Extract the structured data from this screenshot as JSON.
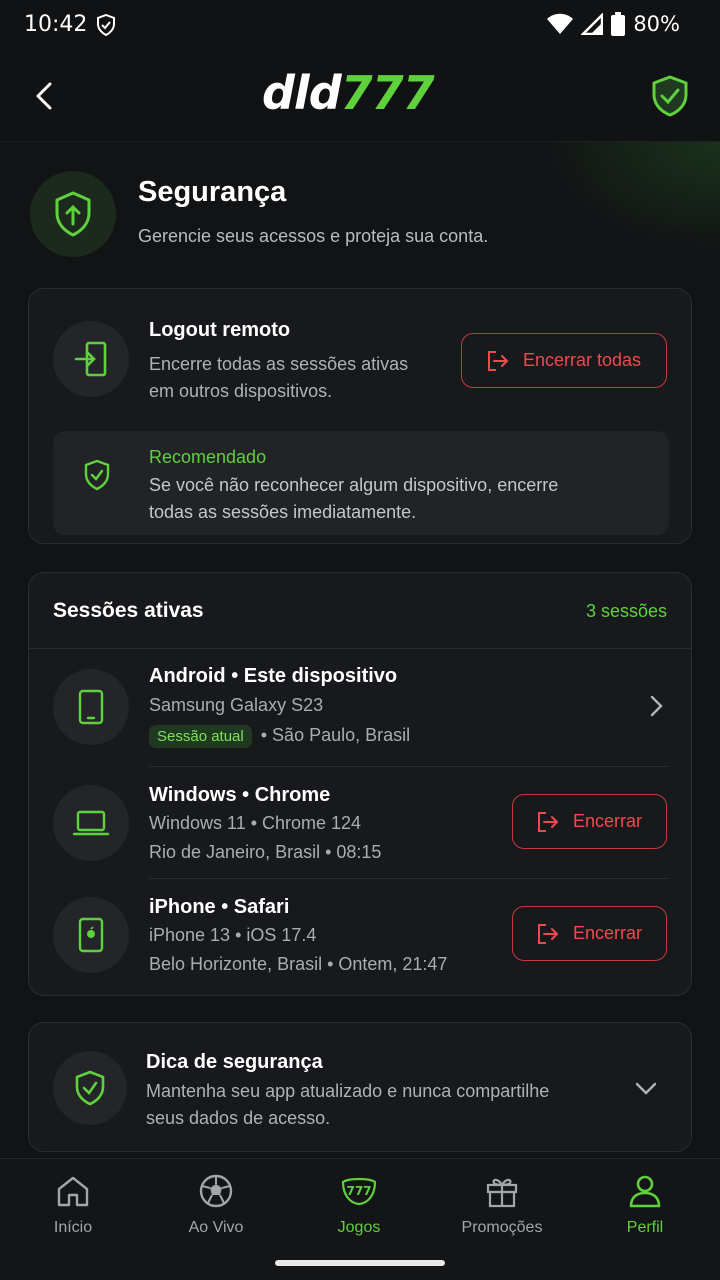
{
  "status_bar": {
    "time": "10:42",
    "battery": "80%"
  },
  "header": {
    "logo_white": "dld",
    "logo_green": "777"
  },
  "page": {
    "title": "Segurança",
    "subtitle": "Gerencie seus acessos e proteja sua conta."
  },
  "logout_card": {
    "title": "Logout remoto",
    "text_line1": "Encerre todas as sessões ativas",
    "text_line2": "em outros dispositivos.",
    "button_label": "Encerrar todas",
    "reco_title": "Recomendado",
    "reco_line1": "Se você não reconhecer algum dispositivo, encerre",
    "reco_line2": "todas as sessões imediatamente."
  },
  "sessions": {
    "title": "Sessões ativas",
    "count": "3 sessões",
    "items": [
      {
        "title": "Android • Este dispositivo",
        "line1": "Samsung Galaxy S23",
        "badge": "Sessão atual",
        "line2": "• São Paulo, Brasil"
      },
      {
        "title": "Windows • Chrome",
        "line1": "Windows 11 • Chrome 124",
        "line2": "Rio de Janeiro, Brasil • 08:15",
        "button_label": "Encerrar"
      },
      {
        "title": "iPhone • Safari",
        "line1": "iPhone 13 • iOS 17.4",
        "line2": "Belo Horizonte, Brasil • Ontem, 21:47",
        "button_label": "Encerrar"
      }
    ]
  },
  "tip_card": {
    "title": "Dica de segurança",
    "line1": "Mantenha seu app atualizado e nunca compartilhe",
    "line2": "seus dados de acesso."
  },
  "bottom_nav": {
    "items": [
      {
        "label": "Início",
        "icon": "home-icon"
      },
      {
        "label": "Ao Vivo",
        "icon": "soccer-ball-icon"
      },
      {
        "label": "Jogos",
        "icon": "777-icon"
      },
      {
        "label": "Promoções",
        "icon": "gift-icon"
      },
      {
        "label": "Perfil",
        "icon": "user-icon"
      }
    ],
    "active": "Perfil"
  },
  "colors": {
    "accent": "#5fd13c",
    "danger": "#ee4a4f",
    "background": "#121315",
    "card": "#18191c"
  }
}
